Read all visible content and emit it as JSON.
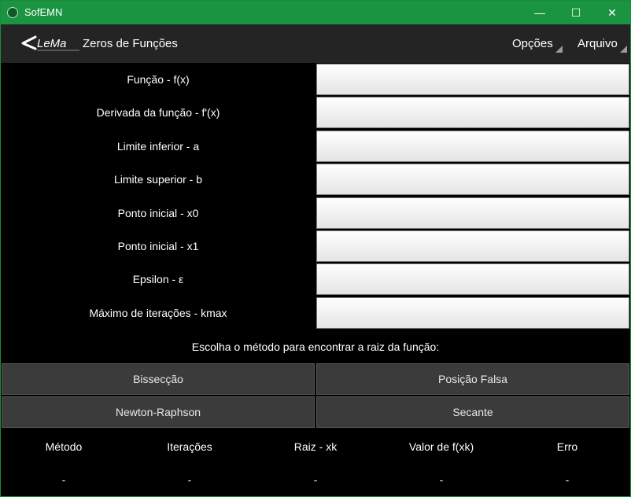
{
  "window": {
    "title": "SofEMN",
    "minimize_glyph": "—",
    "maximize_glyph": "☐",
    "close_glyph": "✕"
  },
  "toolbar": {
    "logo_text": "LeMa",
    "title": "Zeros de Funções",
    "menu_options": "Opções",
    "menu_file": "Arquivo"
  },
  "form": {
    "fields": [
      {
        "label": "Função - f(x)",
        "value": ""
      },
      {
        "label": "Derivada da função - f'(x)",
        "value": ""
      },
      {
        "label": "Limite inferior - a",
        "value": ""
      },
      {
        "label": "Limite superior - b",
        "value": ""
      },
      {
        "label": "Ponto inicial - x0",
        "value": ""
      },
      {
        "label": "Ponto inicial - x1",
        "value": ""
      },
      {
        "label": "Epsilon - ε",
        "value": ""
      },
      {
        "label": "Máximo de iterações - kmax",
        "value": ""
      }
    ]
  },
  "methods": {
    "prompt": "Escolha o método para encontrar a raiz da função:",
    "bisection": "Bissecção",
    "false_position": "Posição Falsa",
    "newton": "Newton-Raphson",
    "secant": "Secante"
  },
  "results": {
    "headers": [
      "Método",
      "Iterações",
      "Raiz - xk",
      "Valor de f(xk)",
      "Erro"
    ],
    "values": [
      "-",
      "-",
      "-",
      "-",
      "-"
    ]
  },
  "colors": {
    "titlebar": "#1a9440",
    "toolbar": "#242424",
    "button": "#3b3b3b",
    "background": "#000000"
  }
}
